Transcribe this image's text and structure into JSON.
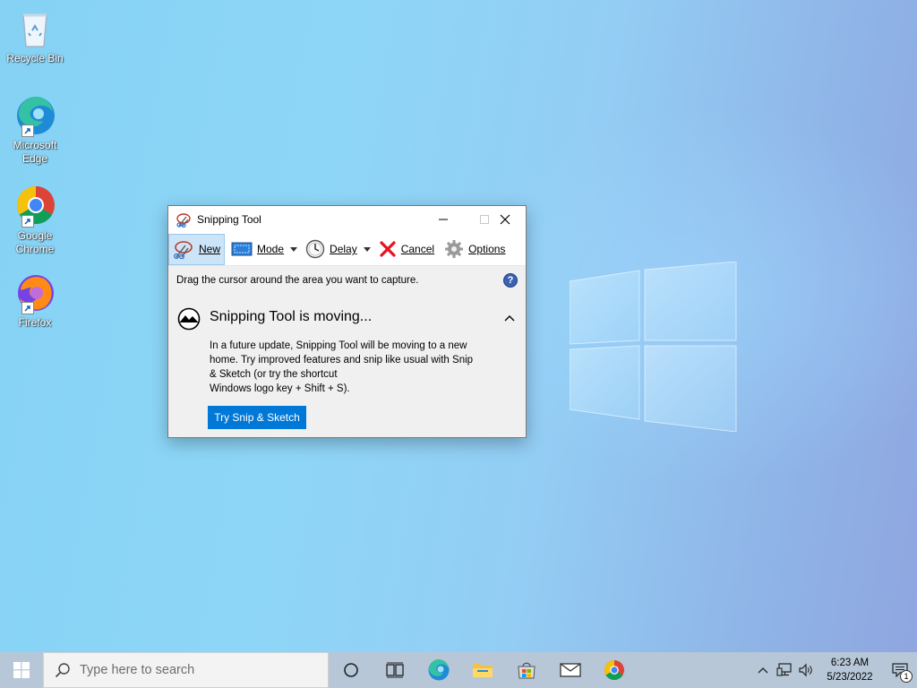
{
  "desktop": {
    "icons": [
      {
        "label": "Recycle Bin",
        "icon": "recycle-bin-icon"
      },
      {
        "label": "Microsoft Edge",
        "icon": "edge-icon"
      },
      {
        "label": "Google Chrome",
        "icon": "chrome-icon"
      },
      {
        "label": "Firefox",
        "icon": "firefox-icon"
      }
    ]
  },
  "window": {
    "title": "Snipping Tool",
    "toolbar": {
      "new_label": "New",
      "mode_label": "Mode",
      "delay_label": "Delay",
      "cancel_label": "Cancel",
      "options_label": "Options"
    },
    "hint": "Drag the cursor around the area you want to capture.",
    "help_glyph": "?",
    "notice": {
      "title": "Snipping Tool is moving...",
      "body_lines": [
        "In a future update, Snipping Tool will be moving to a new",
        "home. Try improved features and snip like usual with Snip",
        "& Sketch (or try the shortcut",
        "Windows logo key + Shift + S)."
      ],
      "button_label": "Try Snip & Sketch"
    }
  },
  "taskbar": {
    "search_placeholder": "Type here to search",
    "apps": [
      "task-view-icon",
      "edge-icon",
      "file-explorer-icon",
      "store-icon",
      "mail-icon",
      "chrome-icon"
    ],
    "clock": {
      "time": "6:23 AM",
      "date": "5/23/2022"
    },
    "notification_count": "1"
  },
  "colors": {
    "accent": "#0078d7",
    "toolbar_active": "#cce4f7",
    "cancel_red": "#e81123"
  }
}
